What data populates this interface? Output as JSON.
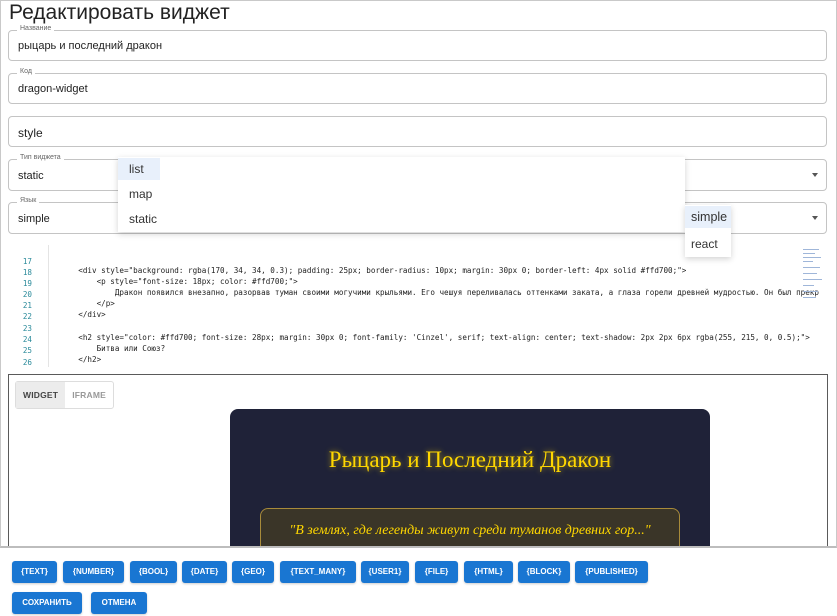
{
  "dialog": {
    "title": "Редактировать виджет"
  },
  "fields": {
    "name": {
      "label": "Название",
      "value": "рыцарь и последний дракон"
    },
    "code": {
      "label": "Код",
      "value": "dragon-widget"
    },
    "style": {
      "value": "style"
    },
    "widget_type": {
      "label": "Тип виджета",
      "value": "static"
    },
    "language": {
      "label": "Язык",
      "value": "simple"
    }
  },
  "widget_type_menu": {
    "options": [
      "list",
      "map",
      "static"
    ],
    "highlighted": "list"
  },
  "language_menu": {
    "options": [
      "simple",
      "react"
    ],
    "highlighted": "simple"
  },
  "code_editor": {
    "lines": [
      {
        "num": "17",
        "text": "    <div style=\"background: rgba(170, 34, 34, 0.3); padding: 25px; border-radius: 10px; margin: 30px 0; border-left: 4px solid #ffd700;\">"
      },
      {
        "num": "18",
        "text": "        <p style=\"font-size: 18px; color: #ffd700;\">"
      },
      {
        "num": "19",
        "text": "            Дракон появился внезапно, разорвав туман своими могучими крыльями. Его чешуя переливалась оттенками заката, а глаза горели древней мудростью. Он был прекр"
      },
      {
        "num": "20",
        "text": "        </p>"
      },
      {
        "num": "21",
        "text": "    </div>"
      },
      {
        "num": "22",
        "text": ""
      },
      {
        "num": "23",
        "text": "    <h2 style=\"color: #ffd700; font-size: 28px; margin: 30px 0; font-family: 'Cinzel', serif; text-align: center; text-shadow: 2px 2px 6px rgba(255, 215, 0, 0.5);\">"
      },
      {
        "num": "24",
        "text": "        Битва или Союз?"
      },
      {
        "num": "25",
        "text": "    </h2>"
      },
      {
        "num": "26",
        "text": ""
      }
    ]
  },
  "preview": {
    "tabs": [
      "WIDGET",
      "IFRAME"
    ],
    "active_tab": "WIDGET",
    "widget_title": "Рыцарь и Последний Дракон",
    "widget_quote": "\"В землях, где легенды живут среди туманов древних гор...\""
  },
  "placeholders": [
    "{TEXT}",
    "{NUMBER}",
    "{BOOL}",
    "{DATE}",
    "{GEO}",
    "{TEXT_MANY}",
    "{USER1}",
    "{FILE}",
    "{HTML}",
    "{BLOCK}",
    "{PUBLISHED}"
  ],
  "actions": {
    "save": "СОХРАНИТЬ",
    "cancel": "ОТМЕНА"
  },
  "colors": {
    "primary": "#1976d2",
    "widget_bg": "#1f2238",
    "gold": "#ffd700"
  }
}
